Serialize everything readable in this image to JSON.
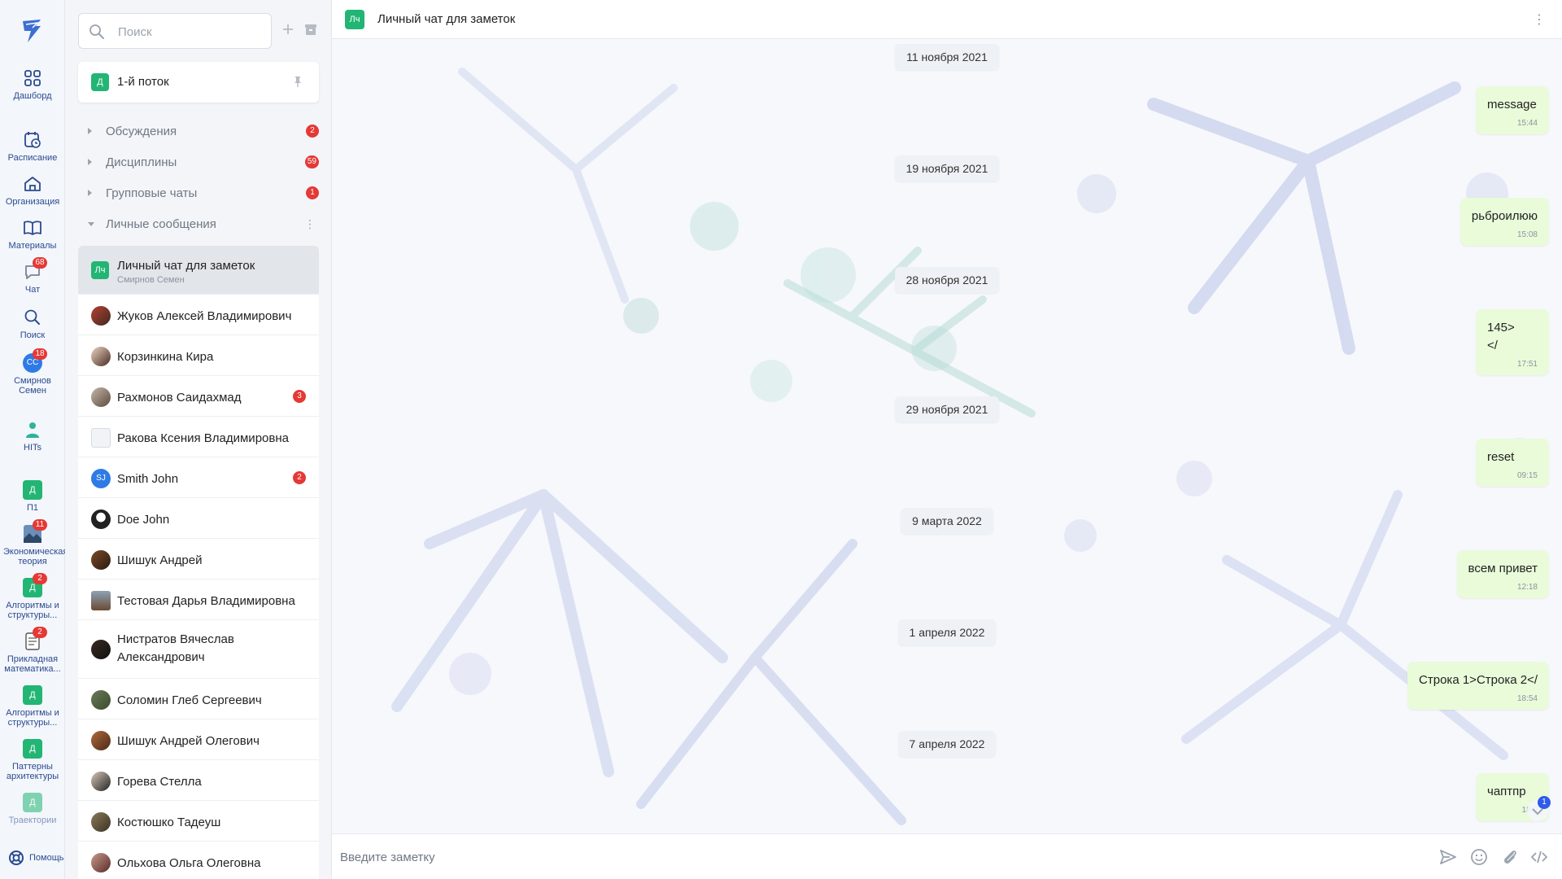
{
  "colors": {
    "accent": "#2b4a8f",
    "badge": "#e53935",
    "stream": "#22b573",
    "bubble": "#e9fbd9"
  },
  "rail": {
    "items": [
      {
        "label": "Дашборд",
        "icon": "grid-icon"
      },
      {
        "label": "Расписание",
        "icon": "calendar-clock-icon"
      },
      {
        "label": "Организация",
        "icon": "home-icon"
      },
      {
        "label": "Материалы",
        "icon": "book-icon"
      },
      {
        "label": "Чат",
        "icon": "chat-icon",
        "badge": "68"
      },
      {
        "label": "Поиск",
        "icon": "search-icon"
      },
      {
        "label": "Смирнов Семен",
        "avatar": "СС",
        "badge": "18"
      },
      {
        "label": "HITs",
        "icon": "person-icon"
      },
      {
        "label": "П1",
        "square": "Д"
      },
      {
        "label": "Экономическая теория",
        "icon": "image-icon",
        "badge": "11"
      },
      {
        "label": "Алгоритмы и структуры...",
        "square": "Д",
        "badge": "2"
      },
      {
        "label": "Прикладная математика...",
        "icon": "doc-icon",
        "badge": "2"
      },
      {
        "label": "Алгоритмы и структуры...",
        "square": "Д"
      },
      {
        "label": "Паттерны архитектуры",
        "square": "Д"
      },
      {
        "label": "Траектории",
        "square": "Д"
      }
    ],
    "help": "Помощь"
  },
  "sidebar": {
    "search_placeholder": "Поиск",
    "stream": {
      "initials": "Д",
      "title": "1-й поток"
    },
    "sections": [
      {
        "label": "Обсуждения",
        "count": "2"
      },
      {
        "label": "Дисциплины",
        "count": "59"
      },
      {
        "label": "Групповые чаты",
        "count": "1"
      },
      {
        "label": "Личные сообщения",
        "count": ""
      }
    ],
    "chats": [
      {
        "name": "Личный чат для заметок",
        "sub": "Смирнов Семен",
        "initials": "Лч",
        "count": ""
      },
      {
        "name": "Жуков Алексей Владимирович",
        "count": ""
      },
      {
        "name": "Корзинкина Кира",
        "count": ""
      },
      {
        "name": "Рахмонов Саидахмад",
        "count": "3"
      },
      {
        "name": "Ракова Ксения Владимировна",
        "count": ""
      },
      {
        "name": "Smith John",
        "initials": "SJ",
        "count": "2"
      },
      {
        "name": "Doe John",
        "count": ""
      },
      {
        "name": "Шишук Андрей",
        "count": ""
      },
      {
        "name": "Тестовая Дарья Владимировна",
        "count": ""
      },
      {
        "name": "Нистратов Вячеслав Александрович",
        "count": ""
      },
      {
        "name": "Соломин Глеб Сергеевич",
        "count": ""
      },
      {
        "name": "Шишук Андрей Олегович",
        "count": ""
      },
      {
        "name": "Горева Стелла",
        "count": ""
      },
      {
        "name": "Костюшко Тадеуш",
        "count": ""
      },
      {
        "name": "Ольхова Ольга Олеговна",
        "count": ""
      }
    ]
  },
  "header": {
    "initials": "Лч",
    "title": "Личный чат для заметок"
  },
  "messages": [
    {
      "date": "11 ноября 2021",
      "text": "message",
      "time": "15:44"
    },
    {
      "date": "19 ноября 2021",
      "text": "рьброилюю",
      "time": "15:08"
    },
    {
      "date": "28 ноября 2021",
      "text": "145>\n</",
      "time": "17:51"
    },
    {
      "date": "29 ноября 2021",
      "text": "reset",
      "time": "09:15"
    },
    {
      "date": "9 марта 2022",
      "text": "всем привет",
      "time": "12:18"
    },
    {
      "date": "1 апреля 2022",
      "text": "Строка 1>Строка 2</",
      "time": "18:54"
    },
    {
      "date": "7 апреля 2022",
      "text": "чаптпр",
      "time": "18:0"
    }
  ],
  "scroll_badge": "1",
  "composer": {
    "placeholder": "Введите заметку"
  }
}
